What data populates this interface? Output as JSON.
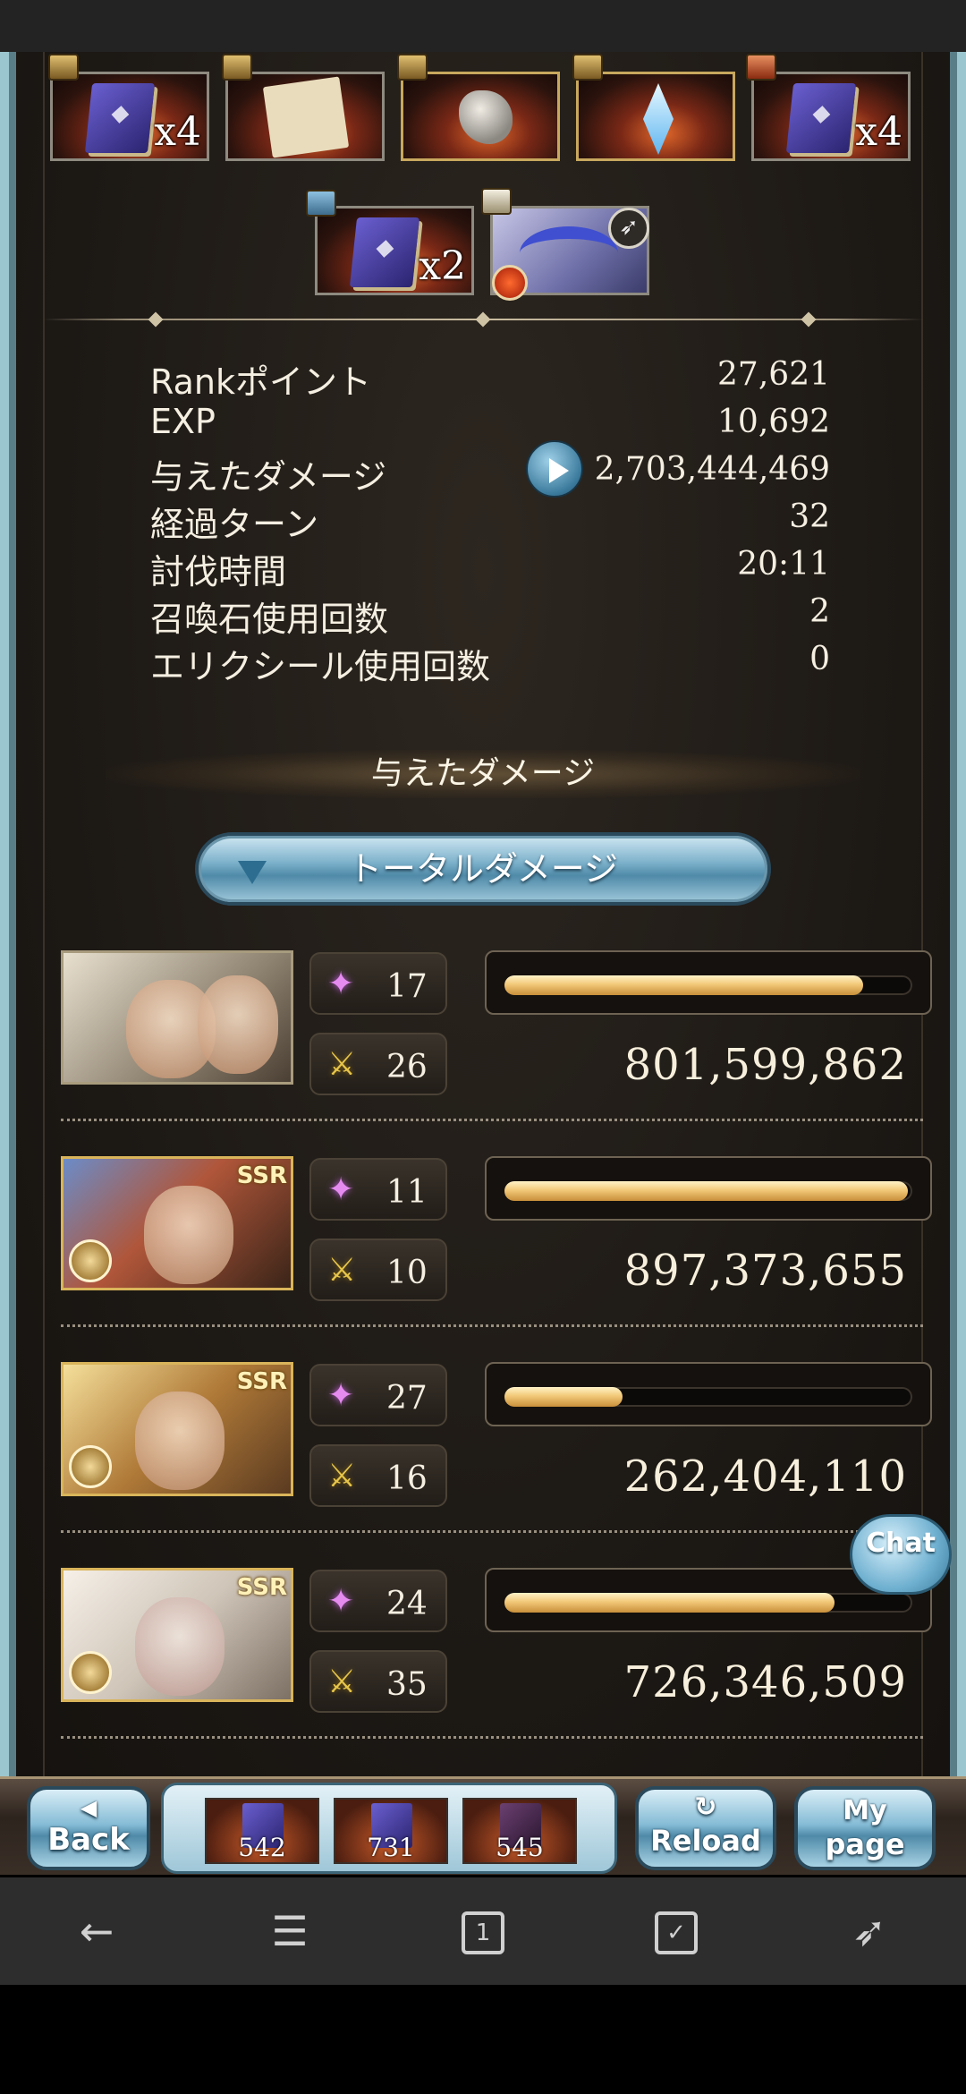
{
  "rewards": {
    "row1": [
      {
        "icon": "book-icon",
        "count": "x4"
      },
      {
        "icon": "scroll-icon",
        "count": ""
      },
      {
        "icon": "ore-icon",
        "count": ""
      },
      {
        "icon": "crystal-icon",
        "count": ""
      },
      {
        "icon": "book-icon",
        "count": "x4"
      }
    ],
    "row2": [
      {
        "icon": "book-icon",
        "count": "x2"
      },
      {
        "icon": "bow-weapon-icon",
        "count": ""
      }
    ]
  },
  "stats": [
    {
      "label": "Rankポイント",
      "value": "27,621"
    },
    {
      "label": "EXP",
      "value": "10,692"
    },
    {
      "label": "与えたダメージ",
      "value": "2,703,444,469"
    },
    {
      "label": "経過ターン",
      "value": "32"
    },
    {
      "label": "討伐時間",
      "value": "20:11"
    },
    {
      "label": "召喚石使用回数",
      "value": "2"
    },
    {
      "label": "エリクシール使用回数",
      "value": "0"
    }
  ],
  "section_title": "与えたダメージ",
  "total_damage_button": "トータルダメージ",
  "characters": [
    {
      "portrait": "twins",
      "rarity": "",
      "ability_uses": "17",
      "attacks": "26",
      "damage": "801,599,862",
      "bar_fraction": 0.88
    },
    {
      "portrait": "dark",
      "rarity": "SSR",
      "ability_uses": "11",
      "attacks": "10",
      "damage": "897,373,655",
      "bar_fraction": 0.99
    },
    {
      "portrait": "blonde",
      "rarity": "SSR",
      "ability_uses": "27",
      "attacks": "16",
      "damage": "262,404,110",
      "bar_fraction": 0.29
    },
    {
      "portrait": "elder",
      "rarity": "SSR",
      "ability_uses": "24",
      "attacks": "35",
      "damage": "726,346,509",
      "bar_fraction": 0.81
    }
  ],
  "chat_label": "Chat",
  "game_nav": {
    "back": "Back",
    "reload": "Reload",
    "mypage_line1": "My",
    "mypage_line2": "page",
    "stocks": [
      "542",
      "731",
      "545"
    ]
  },
  "colors": {
    "bar_fill": "#f2c979",
    "accent_blue": "#7eb2cc",
    "background": "#1d1915"
  }
}
